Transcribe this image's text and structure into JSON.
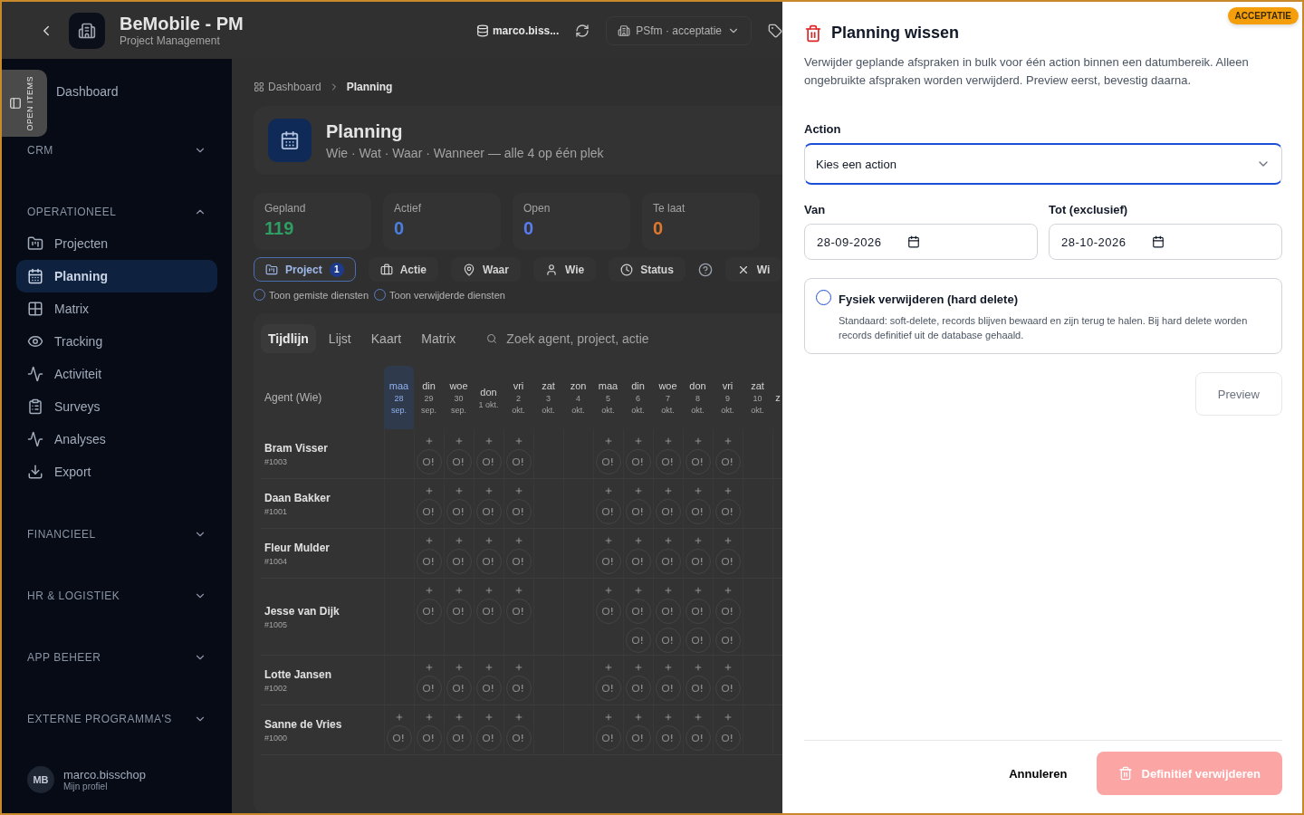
{
  "app_header": {
    "title": "BeMobile - PM",
    "subtitle": "Project Management",
    "user": "marco.biss...",
    "environment": "PSfm · acceptatie"
  },
  "sidebar": {
    "open_items_tab": "OPEN ITEMS",
    "nav": [
      {
        "kind": "link",
        "label": "Dashboard"
      },
      {
        "kind": "group",
        "label": "CRM",
        "expanded": false
      },
      {
        "kind": "group",
        "label": "OPERATIONEEL",
        "expanded": true,
        "children": [
          {
            "label": "Projecten",
            "selected": false
          },
          {
            "label": "Planning",
            "selected": true
          },
          {
            "label": "Matrix",
            "selected": false
          },
          {
            "label": "Tracking",
            "selected": false
          },
          {
            "label": "Activiteit",
            "selected": false
          },
          {
            "label": "Surveys",
            "selected": false
          },
          {
            "label": "Analyses",
            "selected": false
          },
          {
            "label": "Export",
            "selected": false
          }
        ]
      },
      {
        "kind": "group",
        "label": "FINANCIEEL",
        "expanded": false
      },
      {
        "kind": "group",
        "label": "HR & LOGISTIEK",
        "expanded": false
      },
      {
        "kind": "group",
        "label": "APP BEHEER",
        "expanded": false
      },
      {
        "kind": "group",
        "label": "EXTERNE PROGRAMMA'S",
        "expanded": false
      }
    ],
    "profile": {
      "initials": "MB",
      "name": "marco.bisschop",
      "link": "Mijn profiel"
    }
  },
  "breadcrumb": [
    "Dashboard",
    "Planning"
  ],
  "page_header": {
    "title": "Planning",
    "subtitle": "Wie · Wat · Waar · Wanneer — alle 4 op één plek"
  },
  "stats": [
    {
      "label": "Gepland",
      "value": "119",
      "color": "#2e9e62"
    },
    {
      "label": "Actief",
      "value": "0",
      "color": "#4a7fe0"
    },
    {
      "label": "Open",
      "value": "0",
      "color": "#5a7cf0"
    },
    {
      "label": "Te laat",
      "value": "0",
      "color": "#e0772e"
    }
  ],
  "filters": [
    {
      "label": "Project",
      "selected": true,
      "badge": "1"
    },
    {
      "label": "Actie",
      "selected": false
    },
    {
      "label": "Waar",
      "selected": false
    },
    {
      "label": "Wie",
      "selected": false
    },
    {
      "label": "Status",
      "selected": false
    }
  ],
  "clear_filter": {
    "label": "Wi"
  },
  "toggles": [
    {
      "label": "Toon gemiste diensten",
      "checked": false
    },
    {
      "label": "Toon verwijderde diensten",
      "checked": false
    }
  ],
  "view_tabs": [
    {
      "label": "Tijdlijn",
      "selected": true
    },
    {
      "label": "Lijst",
      "selected": false
    },
    {
      "label": "Kaart",
      "selected": false
    },
    {
      "label": "Matrix",
      "selected": false
    }
  ],
  "search": {
    "placeholder": "Zoek agent, project, actie"
  },
  "timeline": {
    "agent_column": "Agent (Wie)",
    "days": [
      {
        "weekday": "maa",
        "day": "28",
        "month": "sep.",
        "today": true
      },
      {
        "weekday": "din",
        "day": "29",
        "month": "sep.",
        "today": false
      },
      {
        "weekday": "woe",
        "day": "30",
        "month": "sep.",
        "today": false
      },
      {
        "weekday": "don",
        "day": "1 okt.",
        "today": false
      },
      {
        "weekday": "vri",
        "day": "2",
        "month": "okt.",
        "today": false
      },
      {
        "weekday": "zat",
        "day": "3",
        "month": "okt.",
        "today": false
      },
      {
        "weekday": "zon",
        "day": "4",
        "month": "okt.",
        "today": false
      },
      {
        "weekday": "maa",
        "day": "5",
        "month": "okt.",
        "today": false
      },
      {
        "weekday": "din",
        "day": "6",
        "month": "okt.",
        "today": false
      },
      {
        "weekday": "woe",
        "day": "7",
        "month": "okt.",
        "today": false
      },
      {
        "weekday": "don",
        "day": "8",
        "month": "okt.",
        "today": false
      },
      {
        "weekday": "vri",
        "day": "9",
        "month": "okt.",
        "today": false
      },
      {
        "weekday": "zat",
        "day": "10",
        "month": "okt.",
        "today": false
      },
      {
        "weekday": "z"
      }
    ],
    "agents": [
      {
        "name": "Bram Visser",
        "id": "#1003",
        "days": [
          {
            "available": false
          },
          {
            "available": true,
            "shifts": [
              {
                "kind": "pending"
              }
            ]
          },
          {
            "available": true,
            "shifts": [
              {
                "kind": "pending"
              }
            ]
          },
          {
            "available": true,
            "shifts": [
              {
                "kind": "pending"
              }
            ]
          },
          {
            "available": true,
            "shifts": [
              {
                "kind": "pending"
              }
            ]
          },
          {
            "available": false
          },
          {
            "available": false
          },
          {
            "available": true,
            "shifts": [
              {
                "kind": "pending"
              }
            ]
          },
          {
            "available": true,
            "shifts": [
              {
                "kind": "pending"
              }
            ]
          },
          {
            "available": true,
            "shifts": [
              {
                "kind": "pending"
              }
            ]
          },
          {
            "available": true,
            "shifts": [
              {
                "kind": "pending"
              }
            ]
          },
          {
            "available": true,
            "shifts": [
              {
                "kind": "pending"
              }
            ]
          },
          {
            "available": false
          }
        ]
      },
      {
        "name": "Daan Bakker",
        "id": "#1001",
        "days": [
          {
            "available": false
          },
          {
            "available": true,
            "shifts": [
              {
                "kind": "pending"
              }
            ]
          },
          {
            "available": true,
            "shifts": [
              {
                "kind": "pending"
              }
            ]
          },
          {
            "available": true,
            "shifts": [
              {
                "kind": "pending"
              }
            ]
          },
          {
            "available": true,
            "shifts": [
              {
                "kind": "pending"
              }
            ]
          },
          {
            "available": false
          },
          {
            "available": false
          },
          {
            "available": true,
            "shifts": [
              {
                "kind": "pending"
              }
            ]
          },
          {
            "available": true,
            "shifts": [
              {
                "kind": "pending"
              }
            ]
          },
          {
            "available": true,
            "shifts": [
              {
                "kind": "pending"
              }
            ]
          },
          {
            "available": true,
            "shifts": [
              {
                "kind": "pending"
              }
            ]
          },
          {
            "available": true,
            "shifts": [
              {
                "kind": "pending"
              }
            ]
          },
          {
            "available": false
          }
        ]
      },
      {
        "name": "Fleur Mulder",
        "id": "#1004",
        "days": [
          {
            "available": false
          },
          {
            "available": true,
            "shifts": [
              {
                "kind": "pending"
              }
            ]
          },
          {
            "available": true,
            "shifts": [
              {
                "kind": "pending"
              }
            ]
          },
          {
            "available": true,
            "shifts": [
              {
                "kind": "pending"
              }
            ]
          },
          {
            "available": true,
            "shifts": [
              {
                "kind": "pending"
              }
            ]
          },
          {
            "available": false
          },
          {
            "available": false
          },
          {
            "available": true,
            "shifts": [
              {
                "kind": "pending"
              }
            ]
          },
          {
            "available": true,
            "shifts": [
              {
                "kind": "pending"
              }
            ]
          },
          {
            "available": true,
            "shifts": [
              {
                "kind": "pending"
              }
            ]
          },
          {
            "available": true,
            "shifts": [
              {
                "kind": "pending"
              }
            ]
          },
          {
            "available": true,
            "shifts": [
              {
                "kind": "pending"
              }
            ]
          },
          {
            "available": false
          }
        ]
      },
      {
        "name": "Jesse van Dijk",
        "id": "#1005",
        "days": [
          {
            "available": false
          },
          {
            "available": true,
            "shifts": [
              {
                "kind": "pending"
              }
            ]
          },
          {
            "available": true,
            "shifts": [
              {
                "kind": "pending"
              }
            ]
          },
          {
            "available": true,
            "shifts": [
              {
                "kind": "pending"
              }
            ]
          },
          {
            "available": true,
            "shifts": [
              {
                "kind": "pending"
              }
            ]
          },
          {
            "available": false
          },
          {
            "available": false
          },
          {
            "available": true,
            "shifts": [
              {
                "kind": "pending"
              }
            ]
          },
          {
            "available": true,
            "shifts": [
              {
                "kind": "pending"
              },
              {
                "kind": "pending"
              }
            ]
          },
          {
            "available": true,
            "shifts": [
              {
                "kind": "pending"
              },
              {
                "kind": "pending"
              }
            ]
          },
          {
            "available": true,
            "shifts": [
              {
                "kind": "pending"
              },
              {
                "kind": "pending"
              }
            ]
          },
          {
            "available": true,
            "shifts": [
              {
                "kind": "pending"
              },
              {
                "kind": "pending"
              }
            ]
          },
          {
            "available": false
          }
        ]
      },
      {
        "name": "Lotte Jansen",
        "id": "#1002",
        "days": [
          {
            "available": false
          },
          {
            "available": true,
            "shifts": [
              {
                "kind": "pending"
              }
            ]
          },
          {
            "available": true,
            "shifts": [
              {
                "kind": "pending"
              }
            ]
          },
          {
            "available": true,
            "shifts": [
              {
                "kind": "pending"
              }
            ]
          },
          {
            "available": true,
            "shifts": [
              {
                "kind": "pending"
              }
            ]
          },
          {
            "available": false
          },
          {
            "available": false
          },
          {
            "available": true,
            "shifts": [
              {
                "kind": "pending"
              }
            ]
          },
          {
            "available": true,
            "shifts": [
              {
                "kind": "pending"
              }
            ]
          },
          {
            "available": true,
            "shifts": [
              {
                "kind": "pending"
              }
            ]
          },
          {
            "available": true,
            "shifts": [
              {
                "kind": "pending"
              }
            ]
          },
          {
            "available": true,
            "shifts": [
              {
                "kind": "pending"
              }
            ]
          },
          {
            "available": false
          }
        ]
      },
      {
        "name": "Sanne de Vries",
        "id": "#1000",
        "days": [
          {
            "available": true,
            "shifts": [
              {
                "kind": "pending"
              }
            ]
          },
          {
            "available": true,
            "shifts": [
              {
                "kind": "pending"
              }
            ]
          },
          {
            "available": true,
            "shifts": [
              {
                "kind": "pending"
              }
            ]
          },
          {
            "available": true,
            "shifts": [
              {
                "kind": "pending"
              }
            ]
          },
          {
            "available": true,
            "shifts": [
              {
                "kind": "pending"
              }
            ]
          },
          {
            "available": false
          },
          {
            "available": false
          },
          {
            "available": true,
            "shifts": [
              {
                "kind": "pending"
              }
            ]
          },
          {
            "available": true,
            "shifts": [
              {
                "kind": "pending"
              }
            ]
          },
          {
            "available": true,
            "shifts": [
              {
                "kind": "pending"
              }
            ]
          },
          {
            "available": true,
            "shifts": [
              {
                "kind": "pending"
              }
            ]
          },
          {
            "available": true,
            "shifts": [
              {
                "kind": "pending"
              }
            ]
          },
          {
            "available": false
          }
        ]
      }
    ]
  },
  "environment_badge": "ACCEPTATIE",
  "dialog": {
    "title": "Planning wissen",
    "description": "Verwijder geplande afspraken in bulk voor één action binnen een datumbereik. Alleen ongebruikte afspraken worden verwijderd. Preview eerst, bevestig daarna.",
    "action": {
      "label": "Action",
      "placeholder": "Kies een action"
    },
    "from": {
      "label": "Van",
      "value": "28-09-2026"
    },
    "to": {
      "label": "Tot (exclusief)",
      "value": "28-10-2026"
    },
    "hard_delete": {
      "label": "Fysiek verwijderen (hard delete)",
      "description": "Standaard: soft-delete, records blijven bewaard en zijn terug te halen. Bij hard delete worden records definitief uit de database gehaald.",
      "checked": false
    },
    "preview_button": "Preview",
    "cancel_button": "Annuleren",
    "confirm_button": {
      "label": "Definitief verwijderen",
      "disabled": true
    }
  }
}
